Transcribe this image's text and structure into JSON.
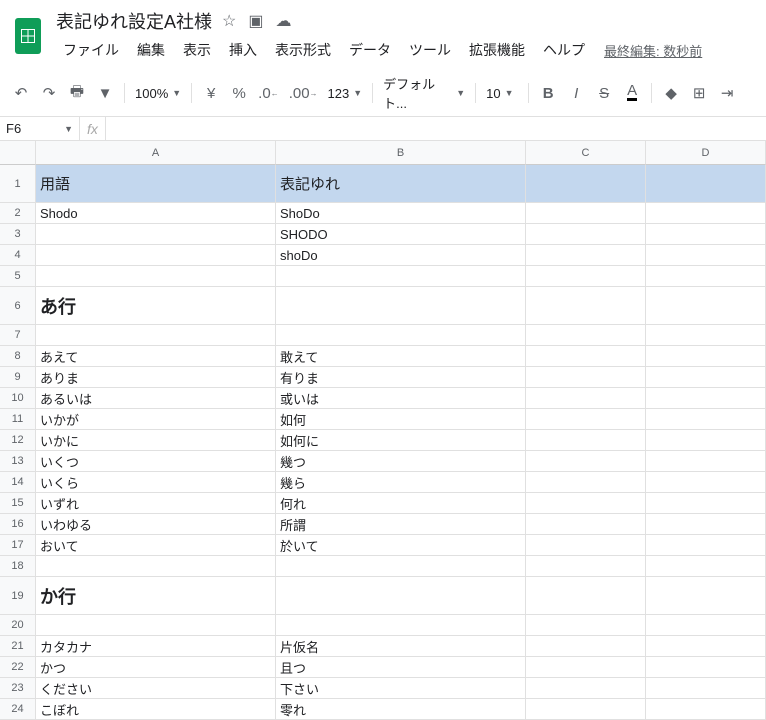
{
  "doc": {
    "title": "表記ゆれ設定A社様"
  },
  "last_edit": "最終編集: 数秒前",
  "menu": [
    "ファイル",
    "編集",
    "表示",
    "挿入",
    "表示形式",
    "データ",
    "ツール",
    "拡張機能",
    "ヘルプ"
  ],
  "toolbar": {
    "zoom": "100%",
    "currency": "¥",
    "percent": "%",
    "dec_dec": ".0",
    "dec_inc": ".00",
    "more_fmt": "123",
    "font": "デフォルト...",
    "font_size": "10"
  },
  "namebox": "F6",
  "formula": "",
  "columns": [
    "A",
    "B",
    "C",
    "D"
  ],
  "rows": [
    {
      "n": 1,
      "h": "tall",
      "a": "用語",
      "b": "表記ゆれ",
      "style": "hdr"
    },
    {
      "n": 2,
      "a": "Shodo",
      "b": "ShoDo"
    },
    {
      "n": 3,
      "a": "",
      "b": "SHODO"
    },
    {
      "n": 4,
      "a": "",
      "b": "shoDo"
    },
    {
      "n": 5,
      "a": "",
      "b": ""
    },
    {
      "n": 6,
      "h": "tall",
      "a": "あ行",
      "b": "",
      "style": "section"
    },
    {
      "n": 7,
      "a": "",
      "b": ""
    },
    {
      "n": 8,
      "a": "あえて",
      "b": "敢えて"
    },
    {
      "n": 9,
      "a": "ありま",
      "b": "有りま"
    },
    {
      "n": 10,
      "a": "あるいは",
      "b": "或いは"
    },
    {
      "n": 11,
      "a": "いかが",
      "b": "如何"
    },
    {
      "n": 12,
      "a": "いかに",
      "b": "如何に"
    },
    {
      "n": 13,
      "a": "いくつ",
      "b": "幾つ"
    },
    {
      "n": 14,
      "a": "いくら",
      "b": "幾ら"
    },
    {
      "n": 15,
      "a": "いずれ",
      "b": "何れ"
    },
    {
      "n": 16,
      "a": "いわゆる",
      "b": "所謂"
    },
    {
      "n": 17,
      "a": "おいて",
      "b": "於いて"
    },
    {
      "n": 18,
      "a": "",
      "b": ""
    },
    {
      "n": 19,
      "h": "tall",
      "a": "か行",
      "b": "",
      "style": "section"
    },
    {
      "n": 20,
      "a": "",
      "b": ""
    },
    {
      "n": 21,
      "a": "カタカナ",
      "b": "片仮名"
    },
    {
      "n": 22,
      "a": "かつ",
      "b": "且つ"
    },
    {
      "n": 23,
      "a": "ください",
      "b": "下さい"
    },
    {
      "n": 24,
      "a": "こぼれ",
      "b": "零れ"
    }
  ]
}
